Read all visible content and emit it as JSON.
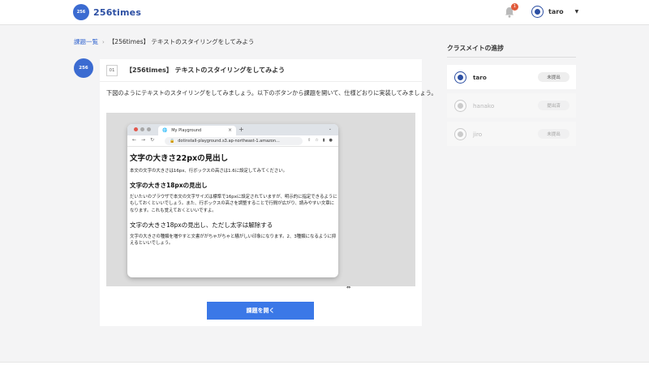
{
  "header": {
    "logo_badge": "256",
    "logo_text": "256times",
    "notification_count": "1",
    "user_name": "taro"
  },
  "breadcrumb": {
    "root": "課題一覧",
    "separator": "›",
    "current": "【256times】 テキストのスタイリングをしてみよう"
  },
  "task": {
    "avatar_text": "256",
    "number": "01",
    "title": "【256times】 テキストのスタイリングをしてみよう",
    "description": "下図のようにテキストのスタイリングをしてみましょう。以下のボタンから課題を開いて、仕様どおりに実装してみましょう。",
    "open_button": "課題を開く"
  },
  "preview": {
    "tab_title": "My Playground",
    "tab_close": "×",
    "tab_plus": "+",
    "tab_dropdown": "⌄",
    "url": "dotinstall-playground.s3.ap-northeast-1.amazon...",
    "nav_back": "←",
    "nav_forward": "→",
    "nav_reload": "↻",
    "h1": "文字の大きさ22pxの見出し",
    "p1": "本文の文字の大きさは16px、行ボックスの高さは1.6に設定してみてください。",
    "h2": "文字の大きさ18pxの見出し",
    "p2": "だいたいのブラウザで本文の文字サイズは標準で16pxに設定されていますが、明示的に指定できるようにもしておくといいでしょう。また、行ボックスの高さを調整することで行間が広がり、読みやすい文章になります。これも覚えておくといいですよ。",
    "h3": "文字の大きさ18pxの見出し、ただし太字は解除する",
    "p3": "文字の大きさの種類を増やすと文書ががちゃがちゃと騒がしい印象になります。2、3種類になるように抑えるといいでしょう。"
  },
  "sidebar": {
    "title": "クラスメイトの進捗",
    "classmates": [
      {
        "name": "taro",
        "status": "未提出"
      },
      {
        "name": "hanako",
        "status": "提出済"
      },
      {
        "name": "jiro",
        "status": "未提出"
      }
    ]
  },
  "colors": {
    "accent": "#3b78e7",
    "brand": "#2c4fa3",
    "notification": "#e15a3a"
  }
}
